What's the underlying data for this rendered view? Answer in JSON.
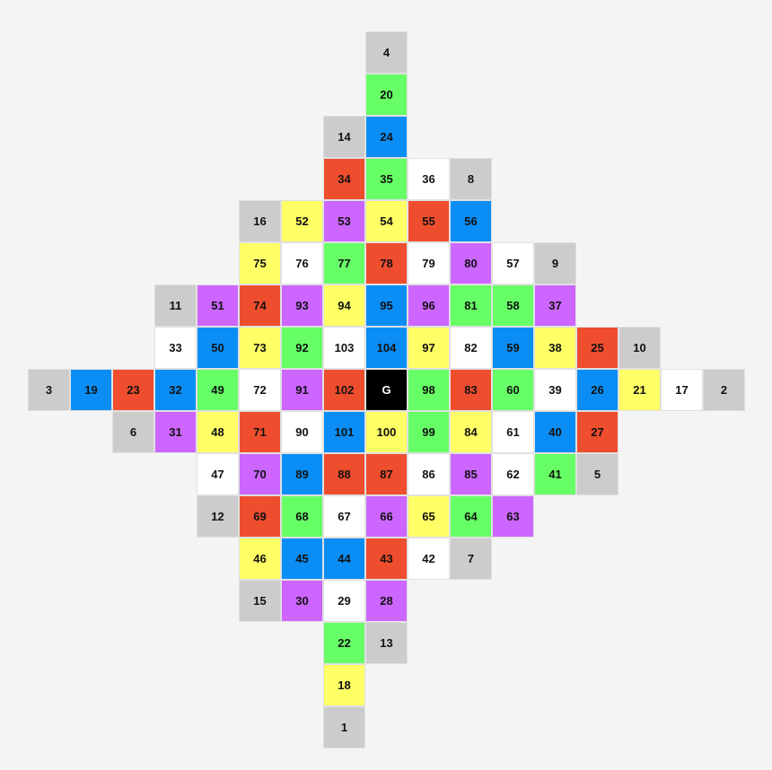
{
  "board": {
    "colors": {
      "grey": "#cccccc",
      "green": "#66ff66",
      "blue": "#0a8ef5",
      "red": "#ee4d2e",
      "white": "#ffffff",
      "yellow": "#ffff66",
      "purple": "#cc66ff",
      "black": "#000000"
    },
    "cells": [
      {
        "label": "4",
        "row": 0,
        "col": 8,
        "color": "grey"
      },
      {
        "label": "20",
        "row": 1,
        "col": 8,
        "color": "green"
      },
      {
        "label": "14",
        "row": 2,
        "col": 7,
        "color": "grey"
      },
      {
        "label": "24",
        "row": 2,
        "col": 8,
        "color": "blue"
      },
      {
        "label": "34",
        "row": 3,
        "col": 7,
        "color": "red"
      },
      {
        "label": "35",
        "row": 3,
        "col": 8,
        "color": "green"
      },
      {
        "label": "36",
        "row": 3,
        "col": 9,
        "color": "white"
      },
      {
        "label": "8",
        "row": 3,
        "col": 10,
        "color": "grey"
      },
      {
        "label": "16",
        "row": 4,
        "col": 5,
        "color": "grey"
      },
      {
        "label": "52",
        "row": 4,
        "col": 6,
        "color": "yellow"
      },
      {
        "label": "53",
        "row": 4,
        "col": 7,
        "color": "purple"
      },
      {
        "label": "54",
        "row": 4,
        "col": 8,
        "color": "yellow"
      },
      {
        "label": "55",
        "row": 4,
        "col": 9,
        "color": "red"
      },
      {
        "label": "56",
        "row": 4,
        "col": 10,
        "color": "blue"
      },
      {
        "label": "75",
        "row": 5,
        "col": 5,
        "color": "yellow"
      },
      {
        "label": "76",
        "row": 5,
        "col": 6,
        "color": "white"
      },
      {
        "label": "77",
        "row": 5,
        "col": 7,
        "color": "green"
      },
      {
        "label": "78",
        "row": 5,
        "col": 8,
        "color": "red"
      },
      {
        "label": "79",
        "row": 5,
        "col": 9,
        "color": "white"
      },
      {
        "label": "80",
        "row": 5,
        "col": 10,
        "color": "purple"
      },
      {
        "label": "57",
        "row": 5,
        "col": 11,
        "color": "white"
      },
      {
        "label": "9",
        "row": 5,
        "col": 12,
        "color": "grey"
      },
      {
        "label": "11",
        "row": 6,
        "col": 3,
        "color": "grey"
      },
      {
        "label": "51",
        "row": 6,
        "col": 4,
        "color": "purple"
      },
      {
        "label": "74",
        "row": 6,
        "col": 5,
        "color": "red"
      },
      {
        "label": "93",
        "row": 6,
        "col": 6,
        "color": "purple"
      },
      {
        "label": "94",
        "row": 6,
        "col": 7,
        "color": "yellow"
      },
      {
        "label": "95",
        "row": 6,
        "col": 8,
        "color": "blue"
      },
      {
        "label": "96",
        "row": 6,
        "col": 9,
        "color": "purple"
      },
      {
        "label": "81",
        "row": 6,
        "col": 10,
        "color": "green"
      },
      {
        "label": "58",
        "row": 6,
        "col": 11,
        "color": "green"
      },
      {
        "label": "37",
        "row": 6,
        "col": 12,
        "color": "purple"
      },
      {
        "label": "33",
        "row": 7,
        "col": 3,
        "color": "white"
      },
      {
        "label": "50",
        "row": 7,
        "col": 4,
        "color": "blue"
      },
      {
        "label": "73",
        "row": 7,
        "col": 5,
        "color": "yellow"
      },
      {
        "label": "92",
        "row": 7,
        "col": 6,
        "color": "green"
      },
      {
        "label": "103",
        "row": 7,
        "col": 7,
        "color": "white"
      },
      {
        "label": "104",
        "row": 7,
        "col": 8,
        "color": "blue"
      },
      {
        "label": "97",
        "row": 7,
        "col": 9,
        "color": "yellow"
      },
      {
        "label": "82",
        "row": 7,
        "col": 10,
        "color": "white"
      },
      {
        "label": "59",
        "row": 7,
        "col": 11,
        "color": "blue"
      },
      {
        "label": "38",
        "row": 7,
        "col": 12,
        "color": "yellow"
      },
      {
        "label": "25",
        "row": 7,
        "col": 13,
        "color": "red"
      },
      {
        "label": "10",
        "row": 7,
        "col": 14,
        "color": "grey"
      },
      {
        "label": "3",
        "row": 8,
        "col": 0,
        "color": "grey"
      },
      {
        "label": "19",
        "row": 8,
        "col": 1,
        "color": "blue"
      },
      {
        "label": "23",
        "row": 8,
        "col": 2,
        "color": "red"
      },
      {
        "label": "32",
        "row": 8,
        "col": 3,
        "color": "blue"
      },
      {
        "label": "49",
        "row": 8,
        "col": 4,
        "color": "green"
      },
      {
        "label": "72",
        "row": 8,
        "col": 5,
        "color": "white"
      },
      {
        "label": "91",
        "row": 8,
        "col": 6,
        "color": "purple"
      },
      {
        "label": "102",
        "row": 8,
        "col": 7,
        "color": "red"
      },
      {
        "label": "G",
        "row": 8,
        "col": 8,
        "color": "black"
      },
      {
        "label": "98",
        "row": 8,
        "col": 9,
        "color": "green"
      },
      {
        "label": "83",
        "row": 8,
        "col": 10,
        "color": "red"
      },
      {
        "label": "60",
        "row": 8,
        "col": 11,
        "color": "green"
      },
      {
        "label": "39",
        "row": 8,
        "col": 12,
        "color": "white"
      },
      {
        "label": "26",
        "row": 8,
        "col": 13,
        "color": "blue"
      },
      {
        "label": "21",
        "row": 8,
        "col": 14,
        "color": "yellow"
      },
      {
        "label": "17",
        "row": 8,
        "col": 15,
        "color": "white"
      },
      {
        "label": "2",
        "row": 8,
        "col": 16,
        "color": "grey"
      },
      {
        "label": "6",
        "row": 9,
        "col": 2,
        "color": "grey"
      },
      {
        "label": "31",
        "row": 9,
        "col": 3,
        "color": "purple"
      },
      {
        "label": "48",
        "row": 9,
        "col": 4,
        "color": "yellow"
      },
      {
        "label": "71",
        "row": 9,
        "col": 5,
        "color": "red"
      },
      {
        "label": "90",
        "row": 9,
        "col": 6,
        "color": "white"
      },
      {
        "label": "101",
        "row": 9,
        "col": 7,
        "color": "blue"
      },
      {
        "label": "100",
        "row": 9,
        "col": 8,
        "color": "yellow"
      },
      {
        "label": "99",
        "row": 9,
        "col": 9,
        "color": "green"
      },
      {
        "label": "84",
        "row": 9,
        "col": 10,
        "color": "yellow"
      },
      {
        "label": "61",
        "row": 9,
        "col": 11,
        "color": "white"
      },
      {
        "label": "40",
        "row": 9,
        "col": 12,
        "color": "blue"
      },
      {
        "label": "27",
        "row": 9,
        "col": 13,
        "color": "red"
      },
      {
        "label": "47",
        "row": 10,
        "col": 4,
        "color": "white"
      },
      {
        "label": "70",
        "row": 10,
        "col": 5,
        "color": "purple"
      },
      {
        "label": "89",
        "row": 10,
        "col": 6,
        "color": "blue"
      },
      {
        "label": "88",
        "row": 10,
        "col": 7,
        "color": "red"
      },
      {
        "label": "87",
        "row": 10,
        "col": 8,
        "color": "red"
      },
      {
        "label": "86",
        "row": 10,
        "col": 9,
        "color": "white"
      },
      {
        "label": "85",
        "row": 10,
        "col": 10,
        "color": "purple"
      },
      {
        "label": "62",
        "row": 10,
        "col": 11,
        "color": "white"
      },
      {
        "label": "41",
        "row": 10,
        "col": 12,
        "color": "green"
      },
      {
        "label": "5",
        "row": 10,
        "col": 13,
        "color": "grey"
      },
      {
        "label": "12",
        "row": 11,
        "col": 4,
        "color": "grey"
      },
      {
        "label": "69",
        "row": 11,
        "col": 5,
        "color": "red"
      },
      {
        "label": "68",
        "row": 11,
        "col": 6,
        "color": "green"
      },
      {
        "label": "67",
        "row": 11,
        "col": 7,
        "color": "white"
      },
      {
        "label": "66",
        "row": 11,
        "col": 8,
        "color": "purple"
      },
      {
        "label": "65",
        "row": 11,
        "col": 9,
        "color": "yellow"
      },
      {
        "label": "64",
        "row": 11,
        "col": 10,
        "color": "green"
      },
      {
        "label": "63",
        "row": 11,
        "col": 11,
        "color": "purple"
      },
      {
        "label": "46",
        "row": 12,
        "col": 5,
        "color": "yellow"
      },
      {
        "label": "45",
        "row": 12,
        "col": 6,
        "color": "blue"
      },
      {
        "label": "44",
        "row": 12,
        "col": 7,
        "color": "blue"
      },
      {
        "label": "43",
        "row": 12,
        "col": 8,
        "color": "red"
      },
      {
        "label": "42",
        "row": 12,
        "col": 9,
        "color": "white"
      },
      {
        "label": "7",
        "row": 12,
        "col": 10,
        "color": "grey"
      },
      {
        "label": "15",
        "row": 13,
        "col": 5,
        "color": "grey"
      },
      {
        "label": "30",
        "row": 13,
        "col": 6,
        "color": "purple"
      },
      {
        "label": "29",
        "row": 13,
        "col": 7,
        "color": "white"
      },
      {
        "label": "28",
        "row": 13,
        "col": 8,
        "color": "purple"
      },
      {
        "label": "22",
        "row": 14,
        "col": 7,
        "color": "green"
      },
      {
        "label": "13",
        "row": 14,
        "col": 8,
        "color": "grey"
      },
      {
        "label": "18",
        "row": 15,
        "col": 7,
        "color": "yellow"
      },
      {
        "label": "1",
        "row": 16,
        "col": 7,
        "color": "grey"
      }
    ]
  }
}
